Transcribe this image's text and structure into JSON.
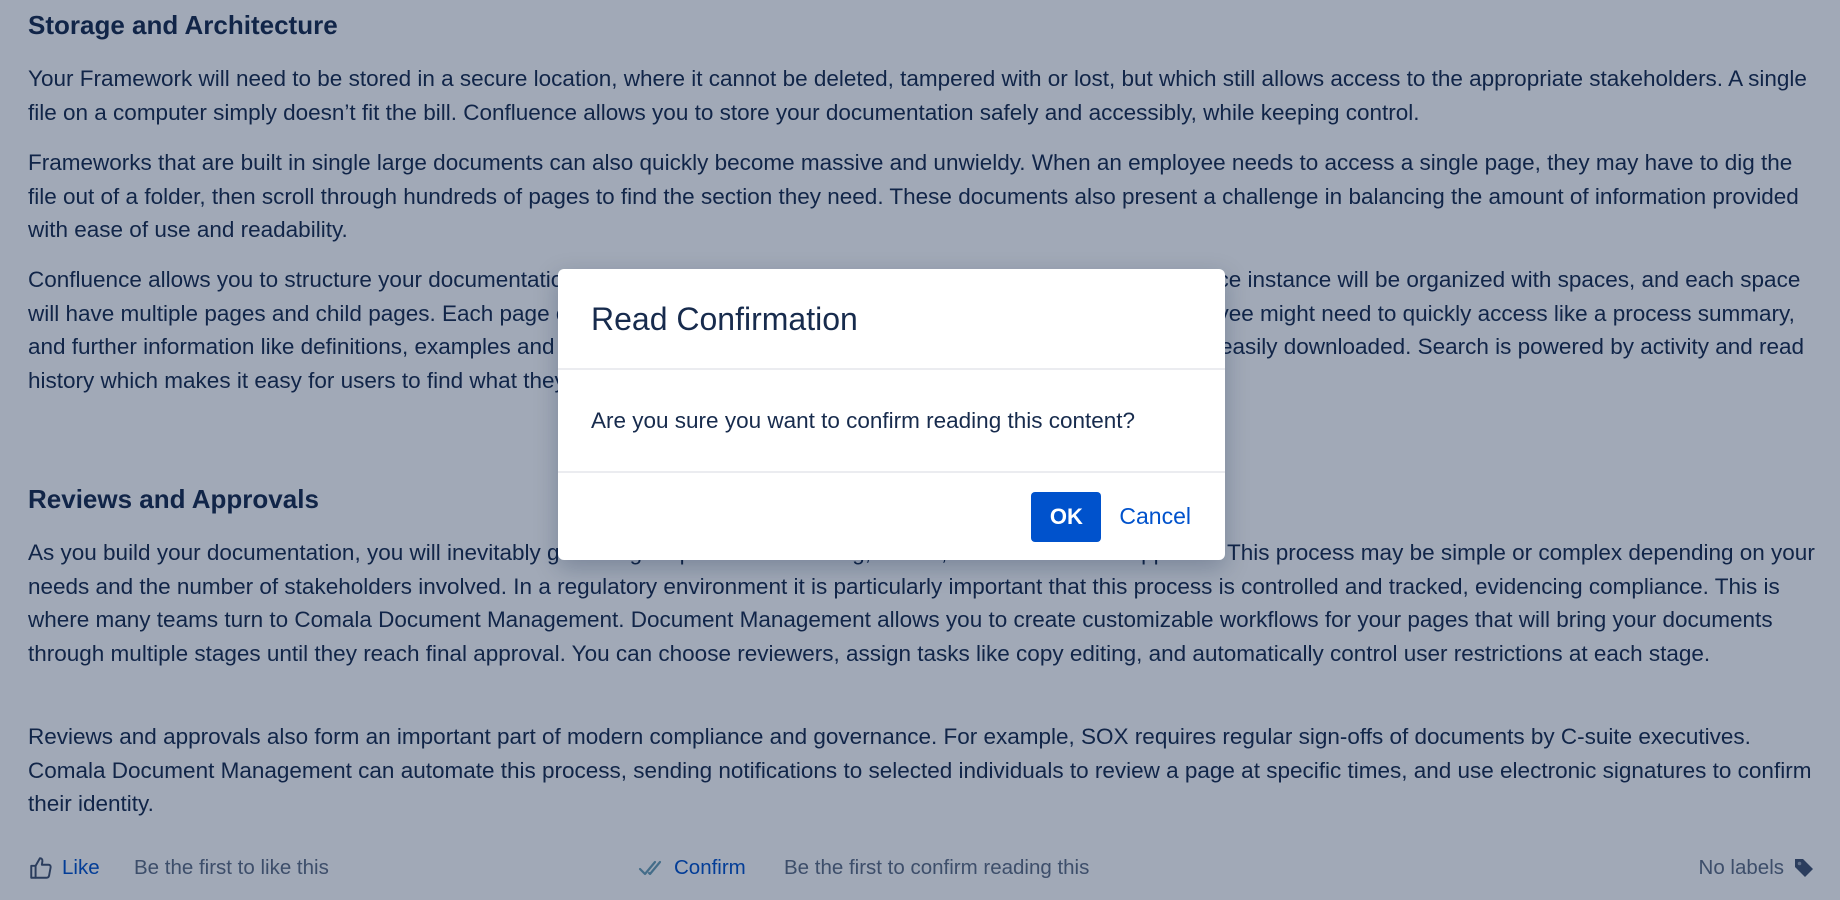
{
  "content": {
    "storage_heading": "Storage and Architecture",
    "storage_p1": "Your Framework will need to be stored in a secure location, where it cannot be deleted, tampered with or lost, but which still allows access to the appropriate stakeholders. A single file on a computer simply doesn’t fit the bill. Confluence allows you to store your documentation safely and accessibly, while keeping control.",
    "storage_p2": "Frameworks that are built in single large documents can also quickly become massive and unwieldy. When an employee needs to access a single page, they may have to dig the file out of a folder, then scroll through hundreds of pages to find the section they need. These documents also present a challenge in balancing the amount of information provided with ease of use and readability.",
    "storage_p3": "Confluence allows you to structure your documentation in a way that is easy to understand and navigate. Your Confluence instance will be organized with spaces, and each space will have multiple pages and child pages. Each page can then be organized with the essential information that an employee might need to quickly access like a process summary, and further information like definitions, examples and explanations. Forms and other files can be attached to pages and easily downloaded. Search is powered by activity and read history which makes it easy for users to find what they’re looking for.",
    "reviews_heading": "Reviews and Approvals",
    "reviews_p1": "As you build your documentation, you will inevitably go through a process of drafting, review, revision and final approval. This process may be simple or complex depending on your needs and the number of stakeholders involved. In a regulatory environment it is particularly important that this process is controlled and tracked, evidencing compliance. This is where many teams turn to Comala Document Management. Document Management allows you to create customizable workflows for your pages that will bring your documents through multiple stages until they reach final approval. You can choose reviewers, assign tasks like copy editing, and automatically control user restrictions at each stage.",
    "reviews_p2": "Reviews and approvals also form an important part of modern compliance and governance. For example, SOX requires regular sign-offs of documents by C-suite executives. Comala Document Management can automate this process, sending notifications to selected individuals to review a page at specific times, and use electronic signatures to confirm their identity."
  },
  "footer": {
    "like_label": "Like",
    "like_text": "Be the first to like this",
    "confirm_label": "Confirm",
    "confirm_text": "Be the first to confirm reading this",
    "labels_text": "No labels",
    "like_icon": "thumbs-up-icon",
    "confirm_icon": "double-check-icon",
    "labels_icon": "tag-icon"
  },
  "dialog": {
    "title": "Read Confirmation",
    "message": "Are you sure you want to confirm reading this content?",
    "ok_label": "OK",
    "cancel_label": "Cancel"
  },
  "colors": {
    "text": "#172B4D",
    "link": "#0052CC",
    "primary_button": "#0052CC",
    "overlay": "rgba(9, 30, 66, 0.38)",
    "muted": "#5E6C84"
  }
}
